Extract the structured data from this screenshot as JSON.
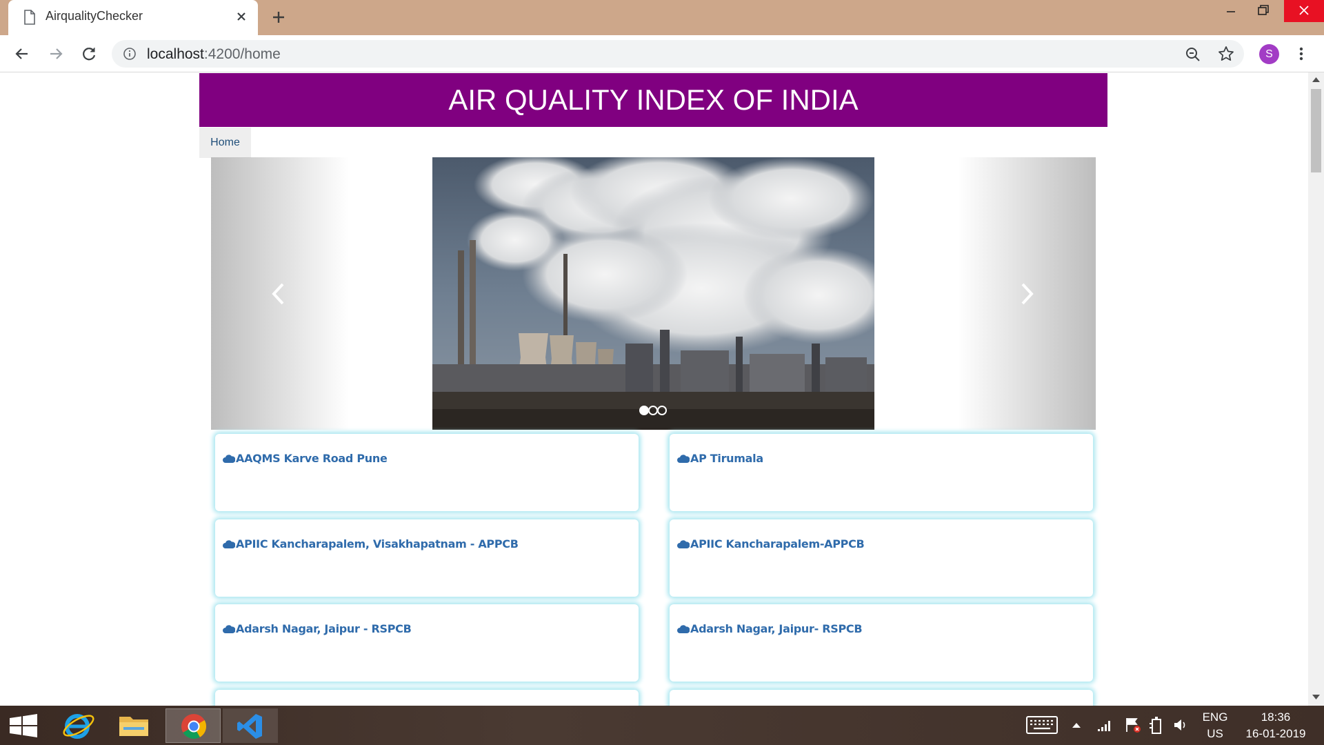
{
  "browser": {
    "tab_title": "AirqualityChecker",
    "url_host": "localhost",
    "url_path": ":4200/home",
    "profile_initial": "S",
    "accent_color": "#a23cc5"
  },
  "page": {
    "header_title": "AIR QUALITY INDEX OF INDIA",
    "header_color": "#800080",
    "nav": {
      "home_label": "Home"
    },
    "carousel": {
      "slide_count": 3,
      "active_slide": 1
    },
    "stations": [
      {
        "name": "AAQMS Karve Road Pune"
      },
      {
        "name": "AP Tirumala"
      },
      {
        "name": "APIIC Kancharapalem, Visakhapatnam - APPCB"
      },
      {
        "name": "APIIC Kancharapalem-APPCB"
      },
      {
        "name": "Adarsh Nagar, Jaipur - RSPCB"
      },
      {
        "name": "Adarsh Nagar, Jaipur- RSPCB"
      },
      {
        "name": ""
      },
      {
        "name": ""
      }
    ],
    "card_link_color": "#2f6bab"
  },
  "taskbar": {
    "language": "ENG",
    "region": "US",
    "time": "18:36",
    "date": "16-01-2019"
  }
}
